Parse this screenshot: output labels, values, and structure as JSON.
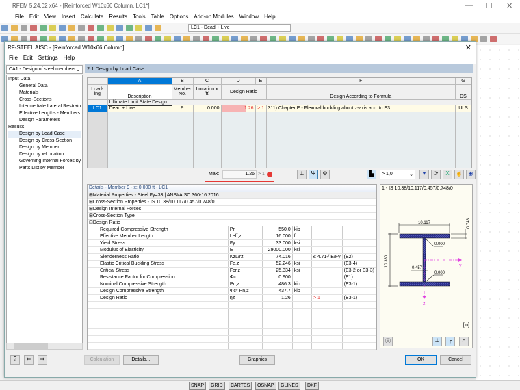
{
  "app": {
    "title": "RFEM 5.24.02 x64 - [Reinforced W10x66 Column, LC1*]",
    "menu": [
      "File",
      "Edit",
      "View",
      "Insert",
      "Calculate",
      "Results",
      "Tools",
      "Table",
      "Options",
      "Add-on Modules",
      "Window",
      "Help"
    ],
    "loadcase_combo": "LC1 - Dead + Live"
  },
  "dialog": {
    "title": "RF-STEEL AISC - [Reinforced W10x66 Column]",
    "menu": [
      "File",
      "Edit",
      "Settings",
      "Help"
    ],
    "case_combo": "CA1 - Design of steel members",
    "tree": [
      {
        "label": "Input Data",
        "level": 1
      },
      {
        "label": "General Data",
        "level": 2
      },
      {
        "label": "Materials",
        "level": 2
      },
      {
        "label": "Cross-Sections",
        "level": 2
      },
      {
        "label": "Intermediate Lateral Restraints",
        "level": 2
      },
      {
        "label": "Effective Lengths - Members",
        "level": 2
      },
      {
        "label": "Design Parameters",
        "level": 2
      },
      {
        "label": "Results",
        "level": 1
      },
      {
        "label": "Design by Load Case",
        "level": 2,
        "selected": true
      },
      {
        "label": "Design by Cross-Section",
        "level": 2
      },
      {
        "label": "Design by Member",
        "level": 2
      },
      {
        "label": "Design by x-Location",
        "level": 2
      },
      {
        "label": "Governing Internal Forces by Member",
        "level": 2
      },
      {
        "label": "Parts List by Member",
        "level": 2
      }
    ],
    "section_title": "2.1 Design by Load Case",
    "table": {
      "col_letters": [
        "A",
        "B",
        "C",
        "D",
        "E",
        "F",
        "G"
      ],
      "headers": {
        "loading": "Load-ing",
        "description": "Description",
        "member": "Member No.",
        "location": "Location x [ft]",
        "ratio": "Design Ratio",
        "formula": "Design According to Formula",
        "ds": "DS"
      },
      "group": "Ultimate Limit State Design",
      "rows": [
        {
          "loading": "LC1",
          "description": "Dead + Live",
          "member": "9",
          "location": "0.000",
          "ratio": "1.26",
          "flag": "> 1",
          "formula": "311) Chapter E - Flexural buckling about z-axis acc. to E3",
          "ds": "ULS",
          "ratio_fraction": 1.26
        }
      ]
    },
    "max": {
      "label": "Max:",
      "value": "1.26",
      "flag": "> 1"
    },
    "filter": "> 1,0",
    "details": {
      "title": "Details - Member 9 - x: 0.000 ft - LC1",
      "groups": [
        "Material Properties - Steel Fy=33 | ANSI/AISC 360-16:2016",
        "Cross-Section Properties  -  IS 10.38/10.117/0.457/0.748/0",
        "Design Internal Forces",
        "Cross-Section Type",
        "Design Ratio"
      ],
      "rows": [
        {
          "name": "Required Compressive Strength",
          "sym": "Pr",
          "val": "550.0",
          "unit": "kip",
          "cond": "",
          "ref": ""
        },
        {
          "name": "Effective Member Length",
          "sym": "Leff,z",
          "val": "16.000",
          "unit": "ft",
          "cond": "",
          "ref": ""
        },
        {
          "name": "Yield Stress",
          "sym": "Fy",
          "val": "33.000",
          "unit": "ksi",
          "cond": "",
          "ref": ""
        },
        {
          "name": "Modulus of Elasticity",
          "sym": "E",
          "val": "29000.000",
          "unit": "ksi",
          "cond": "",
          "ref": ""
        },
        {
          "name": "Slenderness Ratio",
          "sym": "KzL/rz",
          "val": "74.016",
          "unit": "",
          "cond": "≤ 4.71√ E/Fy",
          "ref": "(E2)"
        },
        {
          "name": "Elastic Critical Buckling Stress",
          "sym": "Fe,z",
          "val": "52.246",
          "unit": "ksi",
          "cond": "",
          "ref": "(E3-4)"
        },
        {
          "name": "Critical Stress",
          "sym": "Fcr,z",
          "val": "25.334",
          "unit": "ksi",
          "cond": "",
          "ref": "(E3-2 or E3-3)"
        },
        {
          "name": "Resistance Factor for Compression",
          "sym": "Φc",
          "val": "0.900",
          "unit": "",
          "cond": "",
          "ref": "(E1)"
        },
        {
          "name": "Nominal Compressive Strength",
          "sym": "Pn,z",
          "val": "486.3",
          "unit": "kip",
          "cond": "",
          "ref": "(E3-1)"
        },
        {
          "name": "Design Compressive Strength",
          "sym": "Φc* Pn,z",
          "val": "437.7",
          "unit": "kip",
          "cond": "",
          "ref": ""
        },
        {
          "name": "Design Ratio",
          "sym": "ηz",
          "val": "1.26",
          "unit": "",
          "cond": "> 1",
          "ref": "(B3-1)"
        }
      ]
    },
    "graphic": {
      "title": "1 - IS 10.38/10.117/0.457/0.748/0",
      "width": "10.117",
      "flange": "0.748",
      "height": "10.380",
      "web": "0.457",
      "weld_top": "0.000",
      "weld_bot": "0.000",
      "axis_y": "y",
      "axis_z": "z",
      "unit": "[in]"
    },
    "buttons": {
      "calculation": "Calculation",
      "details": "Details...",
      "graphics": "Graphics",
      "ok": "OK",
      "cancel": "Cancel"
    }
  },
  "statusbar": [
    "SNAP",
    "GRID",
    "CARTES",
    "OSNAP",
    "GLINES",
    "DXF"
  ],
  "colors": {
    "selection": "#0078d7",
    "ratio_bar": "#f7b3b3",
    "error": "#e53935",
    "section_header": "#b8c9dc",
    "profile": "#2b2f8c",
    "axis": "#e040e0"
  }
}
